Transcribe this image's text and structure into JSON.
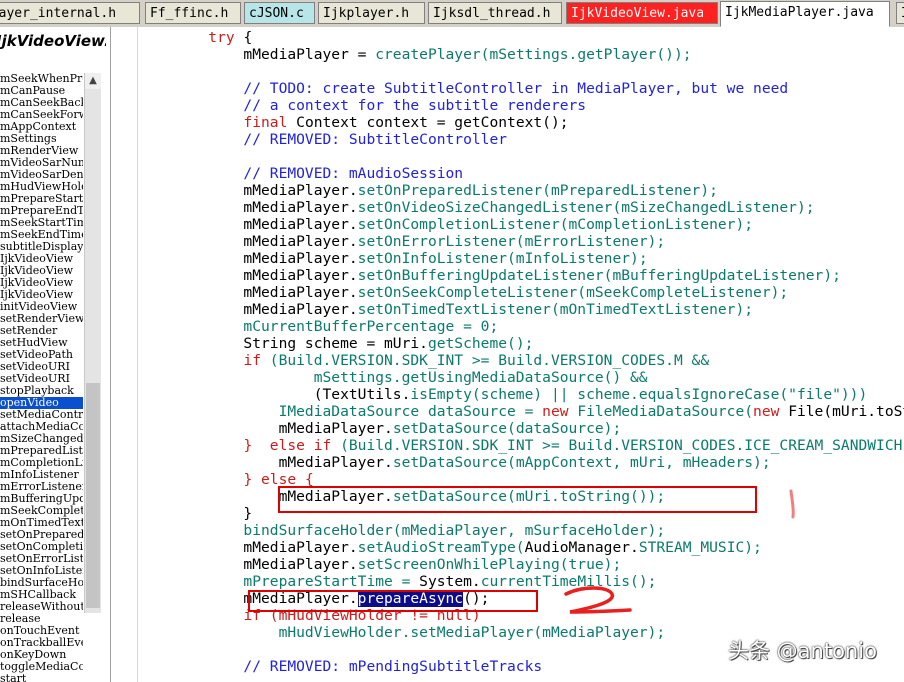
{
  "tabs": [
    {
      "label": "player_internal.h",
      "style": "normal"
    },
    {
      "label": "Ff_ffinc.h",
      "style": "normal"
    },
    {
      "label": "cJSON.c",
      "style": "cyan"
    },
    {
      "label": "Ijkplayer.h",
      "style": "normal"
    },
    {
      "label": "Ijksdl_thread.h",
      "style": "normal"
    },
    {
      "label": "IjkVideoView.java",
      "style": "red"
    },
    {
      "label": "IjkMediaPlayer.java",
      "style": "active"
    },
    {
      "label": "Ij",
      "style": "normal"
    }
  ],
  "left_panel": {
    "title": "IjkVideoView.java",
    "members": [
      "mSeekWhenPrepared",
      "mCanPause",
      "mCanSeekBack",
      "mCanSeekForward",
      "mAppContext",
      "mSettings",
      "mRenderView",
      "mVideoSarNum",
      "mVideoSarDen",
      "mHudViewHolder",
      "mPrepareStartTime",
      "mPrepareEndTime",
      "mSeekStartTime",
      "mSeekEndTime",
      "subtitleDisplay",
      "IjkVideoView",
      "IjkVideoView",
      "IjkVideoView",
      "IjkVideoView",
      "initVideoView",
      "setRenderView",
      "setRender",
      "setHudView",
      "setVideoPath",
      "setVideoURI",
      "setVideoURI",
      "stopPlayback",
      "openVideo",
      "setMediaController",
      "attachMediaController",
      "mSizeChangedListener",
      "mPreparedListener",
      "mCompletionListener",
      "mInfoListener",
      "mErrorListener",
      "mBufferingUpdateListener",
      "mSeekCompleteListener",
      "mOnTimedTextListener",
      "setOnPreparedListener",
      "setOnCompletionListener",
      "setOnErrorListener",
      "setOnInfoListener",
      "bindSurfaceHolder",
      "mSHCallback",
      "releaseWithoutStop",
      "release",
      "onTouchEvent",
      "onTrackballEvent",
      "onKeyDown",
      "toggleMediaControlsVisiblity",
      "start"
    ],
    "selected_member": "openVideo"
  },
  "code_lines": [
    [
      {
        "t": "        "
      },
      {
        "t": "try",
        "c": "kw"
      },
      {
        "t": " {"
      }
    ],
    [
      {
        "t": "            mMediaPlayer = "
      },
      {
        "t": "createPlayer(mSettings.getPlayer());",
        "c": "call"
      }
    ],
    [
      {
        "t": ""
      }
    ],
    [
      {
        "t": "            // TODO: create SubtitleController in MediaPlayer, but we need",
        "c": "cm"
      }
    ],
    [
      {
        "t": "            // a context for the subtitle renderers",
        "c": "cm"
      }
    ],
    [
      {
        "t": "            "
      },
      {
        "t": "final",
        "c": "kw"
      },
      {
        "t": " Context context = getContext();"
      }
    ],
    [
      {
        "t": "            // REMOVED: SubtitleController",
        "c": "cm"
      }
    ],
    [
      {
        "t": ""
      }
    ],
    [
      {
        "t": "            // REMOVED: mAudioSession",
        "c": "cm"
      }
    ],
    [
      {
        "t": "            mMediaPlayer."
      },
      {
        "t": "setOnPreparedListener(mPreparedListener);",
        "c": "call"
      }
    ],
    [
      {
        "t": "            mMediaPlayer."
      },
      {
        "t": "setOnVideoSizeChangedListener(mSizeChangedListener);",
        "c": "call"
      }
    ],
    [
      {
        "t": "            mMediaPlayer."
      },
      {
        "t": "setOnCompletionListener(mCompletionListener);",
        "c": "call"
      }
    ],
    [
      {
        "t": "            mMediaPlayer."
      },
      {
        "t": "setOnErrorListener(mErrorListener);",
        "c": "call"
      }
    ],
    [
      {
        "t": "            mMediaPlayer."
      },
      {
        "t": "setOnInfoListener(mInfoListener);",
        "c": "call"
      }
    ],
    [
      {
        "t": "            mMediaPlayer."
      },
      {
        "t": "setOnBufferingUpdateListener(mBufferingUpdateListener);",
        "c": "call"
      }
    ],
    [
      {
        "t": "            mMediaPlayer."
      },
      {
        "t": "setOnSeekCompleteListener(mSeekCompleteListener);",
        "c": "call"
      }
    ],
    [
      {
        "t": "            mMediaPlayer."
      },
      {
        "t": "setOnTimedTextListener(mOnTimedTextListener);",
        "c": "call"
      }
    ],
    [
      {
        "t": "            mCurrentBufferPercentage = 0;",
        "c": "call"
      }
    ],
    [
      {
        "t": "            String scheme = mUri."
      },
      {
        "t": "getScheme();",
        "c": "call"
      }
    ],
    [
      {
        "t": "            "
      },
      {
        "t": "if",
        "c": "kw"
      },
      {
        "t": " (Build.VERSION.SDK_INT >= Build.VERSION_CODES.M &&",
        "c": "call"
      }
    ],
    [
      {
        "t": "                    mSettings.getUsingMediaDataSource() &&",
        "c": "call"
      }
    ],
    [
      {
        "t": "                    (TextUtils."
      },
      {
        "t": "isEmpty(scheme) || scheme.equalsIgnoreCase(\"file\")))",
        "c": "call"
      }
    ],
    [
      {
        "t": "                IMediaDataSource dataSource = ",
        "c": "call"
      },
      {
        "t": "new",
        "c": "kw"
      },
      {
        "t": " FileMediaDataSource(",
        "c": "call"
      },
      {
        "t": "new",
        "c": "kw"
      },
      {
        "t": " File(mUri.toString()));"
      }
    ],
    [
      {
        "t": "                mMediaPlayer."
      },
      {
        "t": "setDataSource(dataSource);",
        "c": "call"
      }
    ],
    [
      {
        "t": "            "
      },
      {
        "t": "}  else if",
        "c": "kw"
      },
      {
        "t": " (Build.VERSION.SDK_INT >= Build.VERSION_CODES.ICE_CREAM_SANDWICH) {",
        "c": "call"
      }
    ],
    [
      {
        "t": "                mMediaPlayer."
      },
      {
        "t": "setDataSource(mAppContext, mUri, mHeaders);",
        "c": "call"
      }
    ],
    [
      {
        "t": "            "
      },
      {
        "t": "} else {",
        "c": "kw"
      }
    ],
    [
      {
        "t": "                mMediaPlayer."
      },
      {
        "t": "setDataSource(mUri.toString());",
        "c": "call"
      }
    ],
    [
      {
        "t": "            }"
      }
    ],
    [
      {
        "t": "            bindSurfaceHolder(mMediaPlayer, mSurfaceHolder);",
        "c": "call"
      }
    ],
    [
      {
        "t": "            mMediaPlayer."
      },
      {
        "t": "setAudioStreamType(",
        "c": "call"
      },
      {
        "t": "AudioManager."
      },
      {
        "t": "STREAM_MUSIC);",
        "c": "call"
      }
    ],
    [
      {
        "t": "            mMediaPlayer."
      },
      {
        "t": "setScreenOnWhilePlaying(true);",
        "c": "call"
      }
    ],
    [
      {
        "t": "            mPrepareStartTime = ",
        "c": "call"
      },
      {
        "t": "System."
      },
      {
        "t": "currentTimeMillis();",
        "c": "call"
      }
    ],
    [
      {
        "t": "            mMediaPlayer."
      },
      {
        "t": "prepareAsync",
        "c": "hl"
      },
      {
        "t": "();"
      }
    ],
    [
      {
        "t": "            "
      },
      {
        "t": "if (mHudViewHolder != null)",
        "c": "kw"
      }
    ],
    [
      {
        "t": "                mHudViewHolder.setMediaPlayer(mMediaPlayer);",
        "c": "call"
      }
    ],
    [
      {
        "t": ""
      }
    ],
    [
      {
        "t": "            // REMOVED: mPendingSubtitleTracks",
        "c": "cm"
      }
    ]
  ],
  "watermark": "头条 @antonio",
  "colors": {
    "annotation": "#e00000",
    "keyword": "#cc1c1c",
    "comment": "#2222dd",
    "call": "#0b7a6c",
    "selection": "#0a4fcf"
  }
}
